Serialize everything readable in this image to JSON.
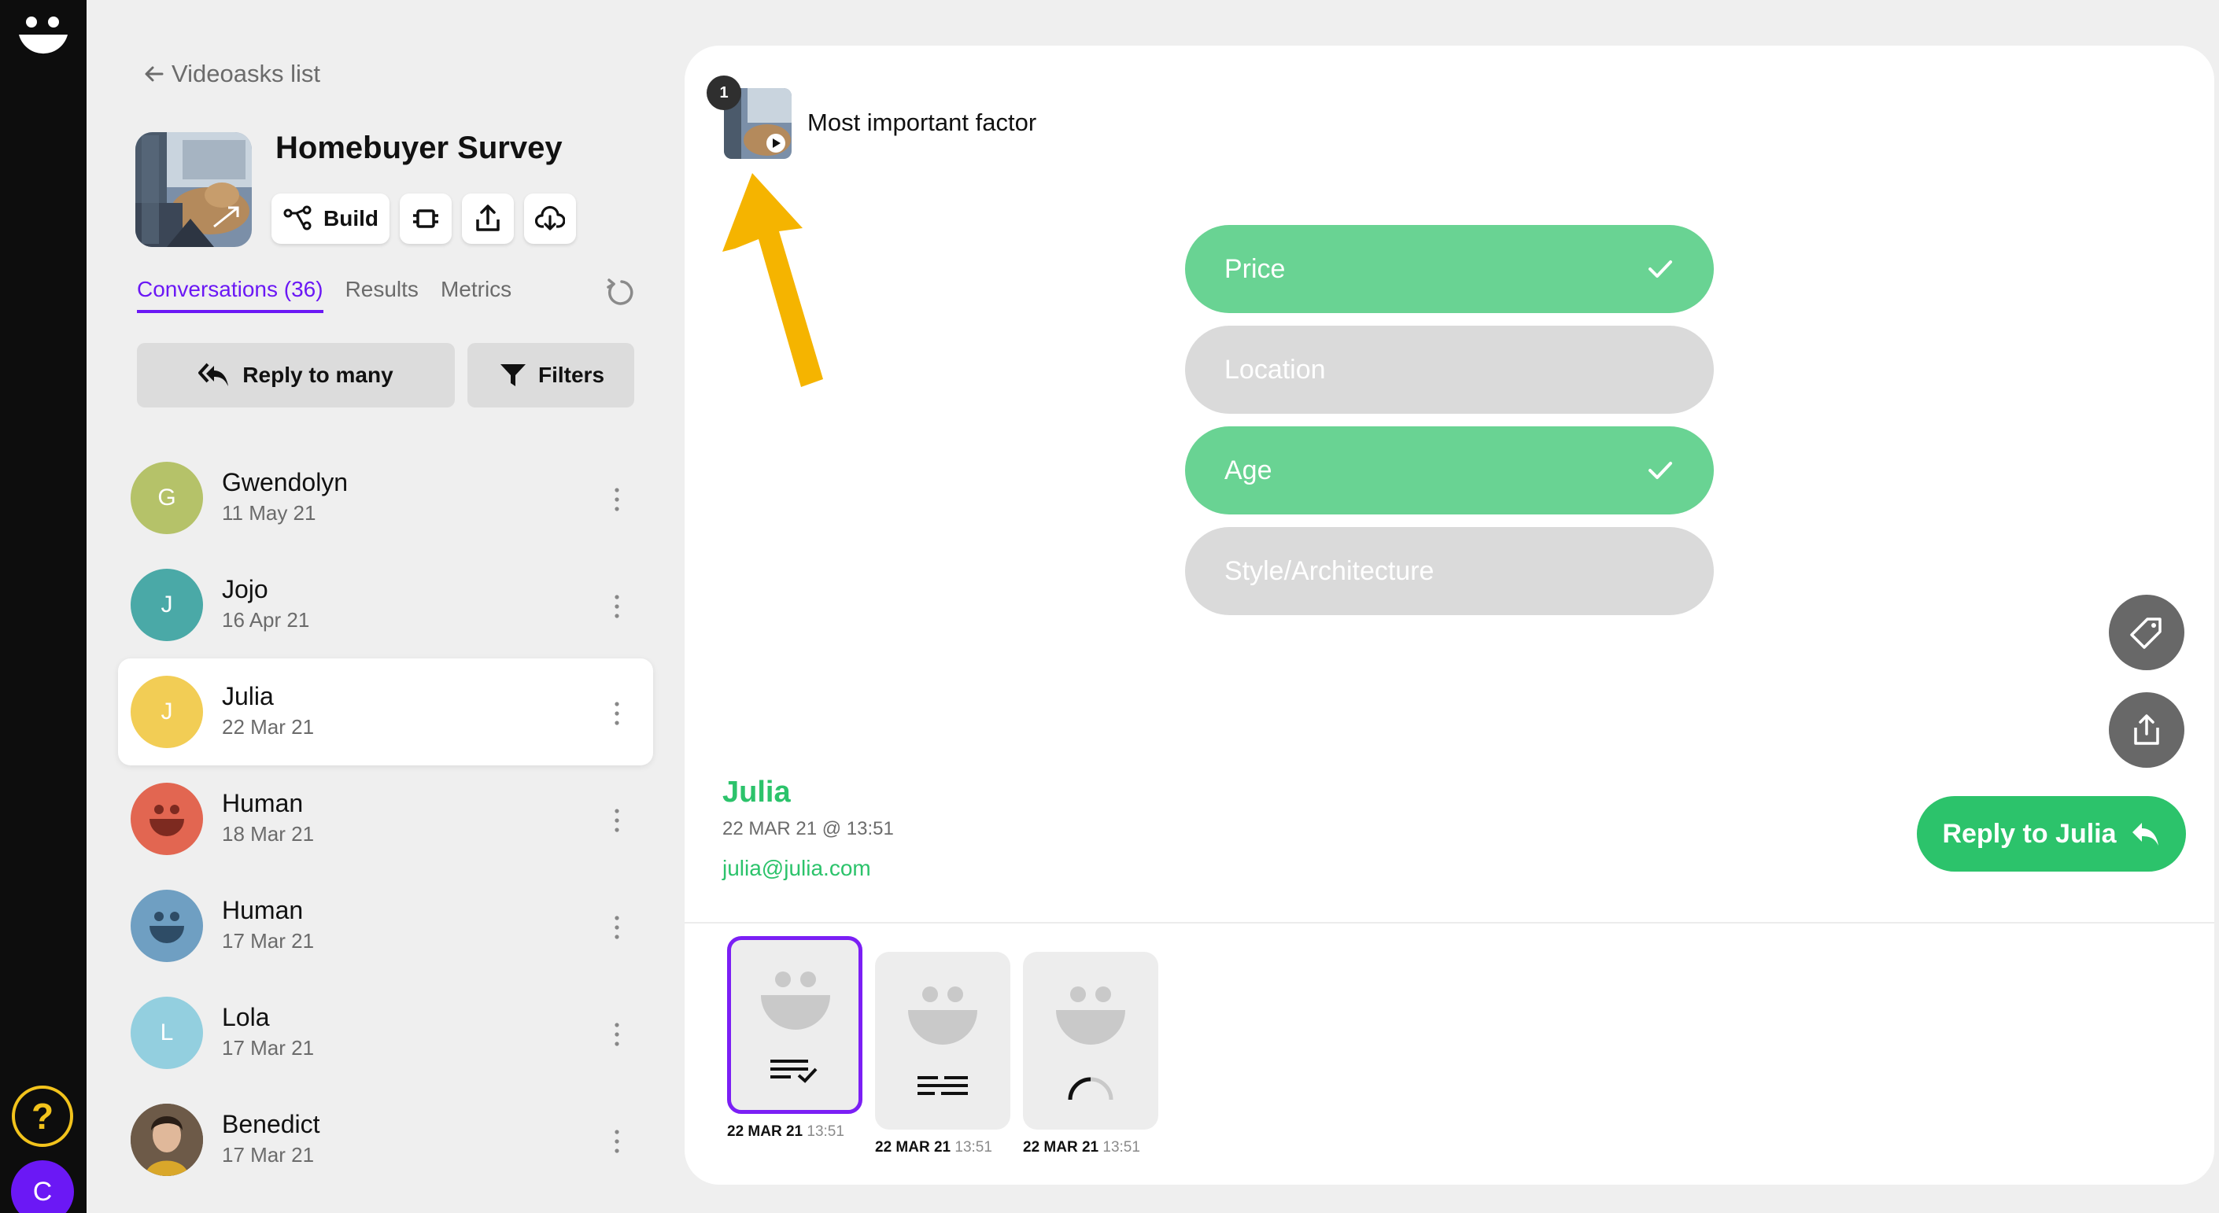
{
  "rail": {
    "help_label": "?",
    "user_initial": "C"
  },
  "back": {
    "label": "Videoasks list"
  },
  "survey": {
    "title": "Homebuyer Survey",
    "build_label": "Build"
  },
  "tabs": [
    {
      "label": "Conversations (36)",
      "active": true
    },
    {
      "label": "Results",
      "active": false
    },
    {
      "label": "Metrics",
      "active": false
    }
  ],
  "actions": {
    "reply_many": "Reply to many",
    "filters": "Filters"
  },
  "conversations": [
    {
      "initial": "G",
      "name": "Gwendolyn",
      "date": "11 May 21",
      "color": "#b5c269",
      "kind": "letter"
    },
    {
      "initial": "J",
      "name": "Jojo",
      "date": "16 Apr 21",
      "color": "#4aa9a7",
      "kind": "letter"
    },
    {
      "initial": "J",
      "name": "Julia",
      "date": "22 Mar 21",
      "color": "#f2cd55",
      "kind": "letter",
      "selected": true
    },
    {
      "initial": "",
      "name": "Human",
      "date": "18 Mar 21",
      "color": "#e26651",
      "kind": "face"
    },
    {
      "initial": "",
      "name": "Human",
      "date": "17 Mar 21",
      "color": "#6f9fc2",
      "kind": "face"
    },
    {
      "initial": "L",
      "name": "Lola",
      "date": "17 Mar 21",
      "color": "#93cfdf",
      "kind": "letter"
    },
    {
      "initial": "",
      "name": "Benedict",
      "date": "17 Mar 21",
      "color": "#5a4a3a",
      "kind": "photo"
    }
  ],
  "question": {
    "number": "1",
    "title": "Most important factor"
  },
  "choices": [
    {
      "label": "Price",
      "selected": true
    },
    {
      "label": "Location",
      "selected": false
    },
    {
      "label": "Age",
      "selected": true
    },
    {
      "label": "Style/Architecture",
      "selected": false
    }
  ],
  "respondent": {
    "name": "Julia",
    "datetime": "22 MAR 21 @ 13:51",
    "email": "julia@julia.com",
    "reply_label": "Reply to Julia"
  },
  "steps": [
    {
      "date": "22 MAR 21",
      "time": "13:51",
      "type": "multiple-choice",
      "active": true
    },
    {
      "date": "22 MAR 21",
      "time": "13:51",
      "type": "text",
      "active": false
    },
    {
      "date": "22 MAR 21",
      "time": "13:51",
      "type": "loading",
      "active": false
    }
  ],
  "colors": {
    "accent": "#6b18f5",
    "green": "#2cc36b",
    "choice_on": "#69d393",
    "choice_off": "#dadada",
    "arrow": "#f5b400"
  }
}
